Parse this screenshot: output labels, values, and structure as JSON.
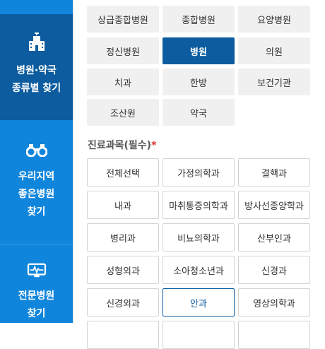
{
  "sidebar": {
    "items": [
      {
        "lines": [
          "병원·약국",
          "종류별 찾기"
        ],
        "icon": "hospital-building-icon",
        "active": true
      },
      {
        "lines": [
          "우리지역",
          "좋은병원",
          "찾기"
        ],
        "icon": "binoculars-icon",
        "active": false
      },
      {
        "lines": [
          "전문병원",
          "찾기"
        ],
        "icon": "specialty-monitor-icon",
        "active": false
      }
    ]
  },
  "hospital_types": {
    "items": [
      "상급종합병원",
      "종합병원",
      "요양병원",
      "정신병원",
      "병원",
      "의원",
      "치과",
      "한방",
      "보건기관",
      "조산원",
      "약국"
    ],
    "selected": "병원"
  },
  "department": {
    "title": "진료과목(필수)",
    "required_mark": "*",
    "items": [
      "전체선택",
      "가정의학과",
      "결핵과",
      "내과",
      "마취통증의학과",
      "방사선종양학과",
      "병리과",
      "비뇨의학과",
      "산부인과",
      "성형외과",
      "소아청소년과",
      "신경과",
      "신경외과",
      "안과",
      "영상의학과"
    ],
    "highlighted": "안과"
  },
  "colors": {
    "sidebar": "#0f85dc",
    "sidebar_active": "#0c5c9f",
    "accent": "#0c5c9f",
    "required": "#e03434"
  }
}
